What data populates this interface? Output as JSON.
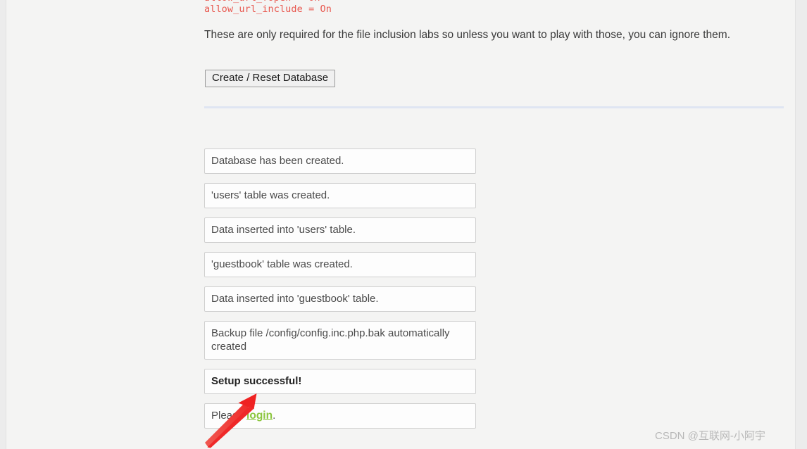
{
  "page": {
    "background_color": "#f4f4f3",
    "divider_color": "#dfe5f2"
  },
  "config": {
    "line_clipped": "allow_url_fopen = On",
    "line_visible": "allow_url_include = On",
    "color": "#e8584f"
  },
  "note": {
    "paragraph": "These are only required for the file inclusion labs so unless you want to play with those, you can ignore them."
  },
  "actions": {
    "reset_database_label": "Create / Reset Database"
  },
  "messages": {
    "items": [
      {
        "text": "Database has been created.",
        "style": "normal"
      },
      {
        "text": "'users' table was created.",
        "style": "normal"
      },
      {
        "text": "Data inserted into 'users' table.",
        "style": "normal"
      },
      {
        "text": "'guestbook' table was created.",
        "style": "normal"
      },
      {
        "text": "Data inserted into 'guestbook' table.",
        "style": "normal"
      },
      {
        "text": "Backup file /config/config.inc.php.bak automatically created",
        "style": "normal"
      },
      {
        "text": "Setup successful!",
        "style": "bold"
      }
    ],
    "login_prefix": "Please ",
    "login_link_label": "login",
    "login_suffix": ".",
    "login_link_color": "#8cc63e"
  },
  "annotation": {
    "arrow_color": "#ee2b2b"
  },
  "watermark": {
    "text": "CSDN @互联网-小阿宇"
  }
}
